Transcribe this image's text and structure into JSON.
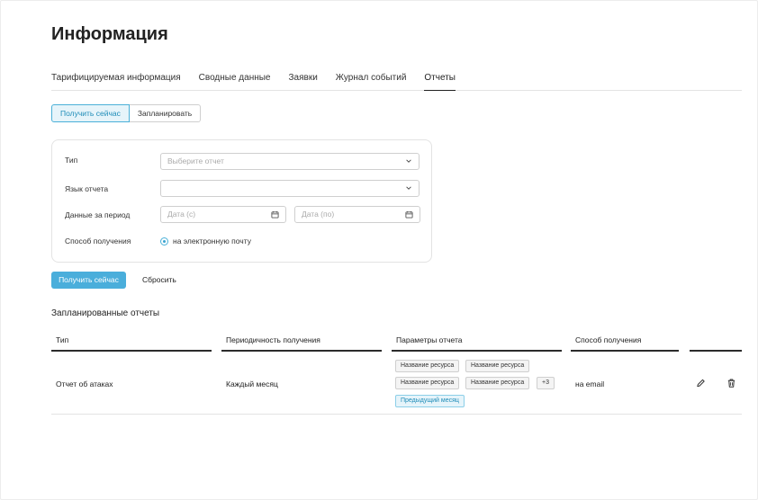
{
  "page": {
    "title": "Информация"
  },
  "tabs": [
    {
      "label": "Тарифицируемая информация",
      "active": false
    },
    {
      "label": "Сводные данные",
      "active": false
    },
    {
      "label": "Заявки",
      "active": false
    },
    {
      "label": "Журнал событий",
      "active": false
    },
    {
      "label": "Отчеты",
      "active": true
    }
  ],
  "mode_switch": {
    "now": "Получить сейчас",
    "schedule": "Запланировать",
    "selected": "now"
  },
  "form": {
    "type_label": "Тип",
    "type_placeholder": "Выберите отчет",
    "language_label": "Язык отчета",
    "language_value": "",
    "period_label": "Данные за период",
    "date_from_placeholder": "Дата (с)",
    "date_to_placeholder": "Дата (по)",
    "delivery_label": "Способ получения",
    "delivery_option": "на электронную почту"
  },
  "actions": {
    "submit": "Получить сейчас",
    "reset": "Сбросить"
  },
  "scheduled": {
    "title": "Запланированные отчеты",
    "columns": [
      "Тип",
      "Периодичность получения",
      "Параметры отчета",
      "Способ получения"
    ],
    "rows": [
      {
        "type": "Отчет об атаках",
        "period": "Каждый месяц",
        "params": [
          "Название ресурса",
          "Название ресурса",
          "Название ресурса",
          "Название ресурса"
        ],
        "more": "+3",
        "period_param": "Предыдущий месяц",
        "delivery": "на email"
      }
    ]
  },
  "icons": {
    "chevron": "chevron-down-icon",
    "calendar": "calendar-icon",
    "edit": "pencil-icon",
    "delete": "trash-icon"
  },
  "colors": {
    "accent": "#4aaedb",
    "accent_light": "#e6f4fa",
    "accent_text": "#1e8cb8"
  }
}
